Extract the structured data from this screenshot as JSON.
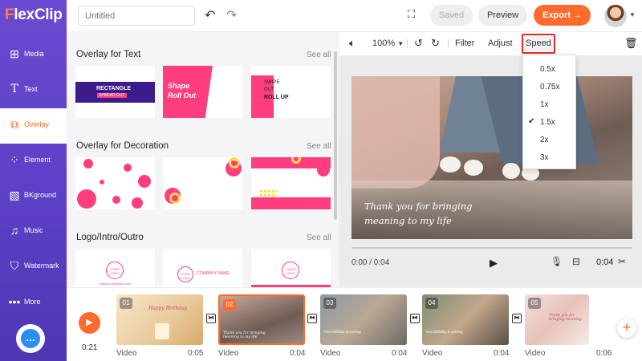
{
  "app": {
    "logo_prefix": "F",
    "logo_rest": "lexClip"
  },
  "sidebar": {
    "items": [
      {
        "label": "Media",
        "icon": "media-icon"
      },
      {
        "label": "Text",
        "icon": "text-icon"
      },
      {
        "label": "Overlay",
        "icon": "overlay-icon"
      },
      {
        "label": "Element",
        "icon": "element-icon"
      },
      {
        "label": "BKground",
        "icon": "background-icon"
      },
      {
        "label": "Music",
        "icon": "music-icon"
      },
      {
        "label": "Watermark",
        "icon": "watermark-icon"
      },
      {
        "label": "More",
        "icon": "more-icon"
      }
    ]
  },
  "header": {
    "title_placeholder": "Untitled",
    "saved_label": "Saved",
    "preview_label": "Preview",
    "export_label": "Export →"
  },
  "panel": {
    "sections": [
      {
        "title": "Overlay for Text",
        "see_all": "See all"
      },
      {
        "title": "Overlay for Decoration",
        "see_all": "See all"
      },
      {
        "title": "Logo/Intro/Outro",
        "see_all": "See all"
      }
    ],
    "text_cards": [
      {
        "line1": "RECTANGLE",
        "line2": "SPREAD OUT"
      },
      {
        "line1": "Shape",
        "line2": "Roll Out"
      },
      {
        "line1": "SWIPE",
        "line2": "OUT",
        "line3": "ROLL UP"
      }
    ],
    "logo_cards": [
      {
        "badge": "YOUR LOGO",
        "caption": "www.yourwebsite.com"
      },
      {
        "badge": "YOUR LOGO",
        "caption": "COMPANY NAME"
      },
      {
        "badge": "YOUR LOGO",
        "caption": ""
      }
    ]
  },
  "toolbar": {
    "zoom": "100%",
    "filter_label": "Filter",
    "adjust_label": "Adjust",
    "speed_label": "Speed"
  },
  "speed_menu": {
    "options": [
      "0.5x",
      "0.75x",
      "1x",
      "1.5x",
      "2x",
      "3x"
    ],
    "selected": "1.5x"
  },
  "preview": {
    "caption_line1": "Thank you for bringing",
    "caption_line2": "meaning to my life",
    "time": "0:00 / 0:04",
    "duration": "0:04"
  },
  "timeline": {
    "total": "0:21",
    "clips": [
      {
        "num": "01",
        "label": "Video",
        "duration": "0:05",
        "caption": "Happy Birthday"
      },
      {
        "num": "02",
        "label": "Video",
        "duration": "0:04",
        "caption": "Thank you for bringing meaning to my life"
      },
      {
        "num": "03",
        "label": "Video",
        "duration": "0:04",
        "caption": "Your birthday is coming"
      },
      {
        "num": "04",
        "label": "Video",
        "duration": "0:04",
        "caption": "Your birthday is coming"
      },
      {
        "num": "05",
        "label": "Video",
        "duration": "0:06",
        "caption": "Thank you for bringing meaning"
      }
    ]
  },
  "colors": {
    "accent": "#ff6b2d",
    "sidebar": "#5b3fc4",
    "pink": "#ff3d7f",
    "speed_highlight": "#d9322e"
  }
}
